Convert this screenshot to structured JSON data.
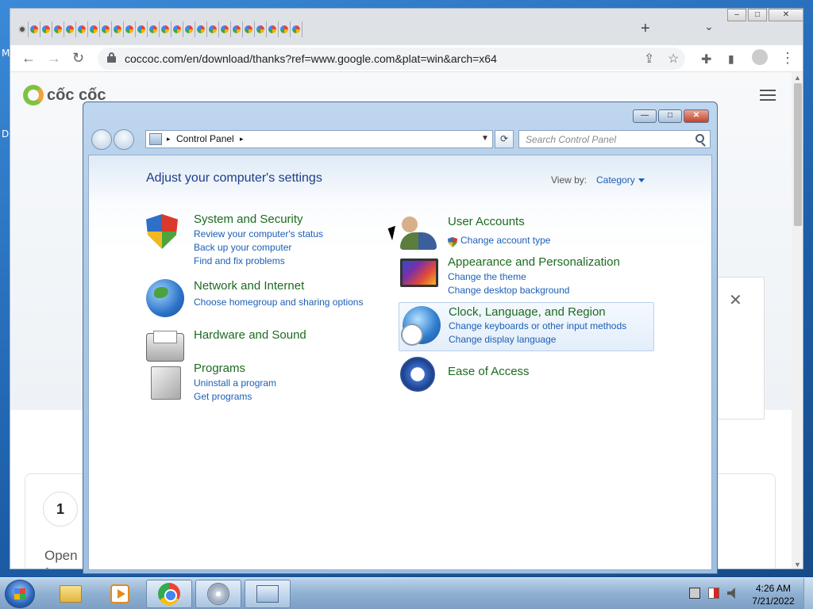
{
  "desktop": {
    "fragments": [
      "M",
      "D"
    ]
  },
  "browser": {
    "url": "coccoc.com/en/download/thanks?ref=www.google.com&plat=win&arch=x64",
    "tab_count": 24,
    "new_tab_label": "+",
    "tab_search_label": "⌄",
    "win_minimize": "–",
    "win_maximize": "□",
    "win_close": "✕",
    "back_glyph": "←",
    "forward_glyph": "→",
    "reload_glyph": "↻",
    "share_glyph": "⇪",
    "star_glyph": "☆",
    "ext_glyph": "✚",
    "sidepanel_glyph": "▮",
    "menu_glyph": "⋮",
    "page": {
      "logo_text": "cốc cốc",
      "popup_close": "✕",
      "step_number": "1",
      "step_text": "Open from t"
    }
  },
  "control_panel": {
    "title_buttons": {
      "minimize": "—",
      "maximize": "□",
      "close": "✕"
    },
    "address": {
      "segment": "Control Panel",
      "arrow": "▸",
      "dropdown": "▼",
      "refresh": "⟳"
    },
    "search": {
      "placeholder": "Search Control Panel"
    },
    "heading": "Adjust your computer's settings",
    "view_by_label": "View by:",
    "view_by_value": "Category",
    "categories": [
      {
        "title": "System and Security",
        "icon": "shield-icon",
        "links": [
          "Review your computer's status",
          "Back up your computer",
          "Find and fix problems"
        ]
      },
      {
        "title": "Network and Internet",
        "icon": "network-globe-icon",
        "links": [
          "Choose homegroup and sharing options"
        ]
      },
      {
        "title": "Hardware and Sound",
        "icon": "printer-icon",
        "links": []
      },
      {
        "title": "Programs",
        "icon": "programs-box-icon",
        "links": [
          "Uninstall a program",
          "Get programs"
        ]
      },
      {
        "title": "User Accounts",
        "icon": "users-icon",
        "links": [
          "Change account type"
        ]
      },
      {
        "title": "Appearance and Personalization",
        "icon": "monitor-icon",
        "links": [
          "Change the theme",
          "Change desktop background"
        ]
      },
      {
        "title": "Clock, Language, and Region",
        "icon": "clock-globe-icon",
        "links": [
          "Change keyboards or other input methods",
          "Change display language"
        ]
      },
      {
        "title": "Ease of Access",
        "icon": "ease-of-access-icon",
        "links": []
      }
    ]
  },
  "taskbar": {
    "items": [
      "explorer",
      "media-player",
      "chrome",
      "disc",
      "control-panel"
    ],
    "active_item": "control-panel",
    "clock_time": "4:26 AM",
    "clock_date": "7/21/2022"
  }
}
